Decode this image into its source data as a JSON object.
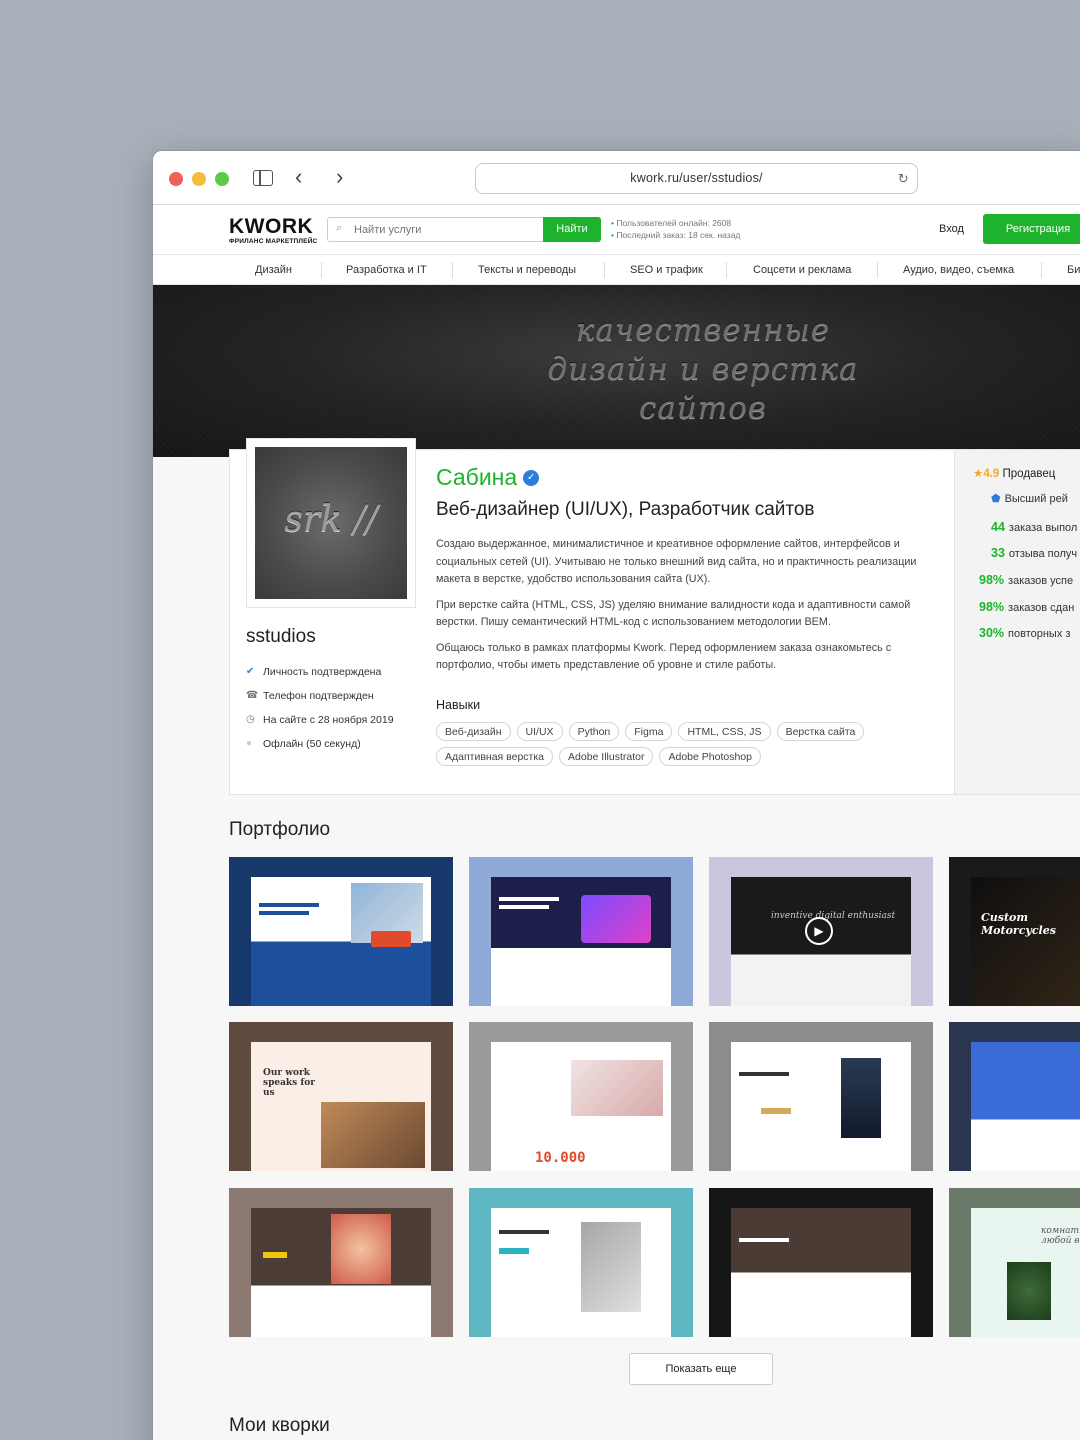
{
  "browser": {
    "url": "kwork.ru/user/sstudios/"
  },
  "header": {
    "logo": "KWORK",
    "logo_sub": "ФРИЛАНС МАРКЕТПЛЕЙС",
    "search_placeholder": "Найти услуги",
    "search_button": "Найти",
    "stats_online": "Пользователей онлайн: 2608",
    "stats_last_order": "Последний заказ: 18 сек. назад",
    "login": "Вход",
    "register": "Регистрация"
  },
  "categories": [
    "Дизайн",
    "Разработка и IT",
    "Тексты и переводы",
    "SEO и трафик",
    "Соцсети и реклама",
    "Аудио, видео, съемка",
    "Би"
  ],
  "banner": {
    "text": "качественные\nдизайн и верстка\nсайтов"
  },
  "profile": {
    "avatar_text": "srk //",
    "username": "sstudios",
    "facts": [
      {
        "icon": "verified-icon",
        "text": "Личность подтверждена"
      },
      {
        "icon": "phone-icon",
        "text": "Телефон подтвержден"
      },
      {
        "icon": "clock-icon",
        "text": "На сайте с 28 ноября 2019"
      },
      {
        "icon": "status-dot-icon",
        "text": "Офлайн (50 секунд)"
      }
    ],
    "name": "Сабина",
    "title": "Веб-дизайнер (UI/UX), Разработчик сайтов",
    "about": [
      "Создаю выдержанное, минималистичное и креативное оформление сайтов, интерфейсов и социальных сетей (UI). Учитываю не только внешний вид сайта, но и практичность реализации макета в верстке, удобство использования сайта (UX).",
      "При верстке сайта (HTML, CSS, JS) уделяю внимание валидности кода и адаптивности самой верстки. Пишу семантический HTML-код с использованием методологии BEM.",
      "Общаюсь только в рамках платформы Kwork. Перед оформлением заказа ознакомьтесь с портфолио, чтобы иметь представление об уровне и стиле работы."
    ],
    "skills_title": "Навыки",
    "skills": [
      "Веб-дизайн",
      "UI/UX",
      "Python",
      "Figma",
      "HTML, CSS, JS",
      "Верстка сайта",
      "Адаптивная верстка",
      "Adobe Illustrator",
      "Adobe Photoshop"
    ]
  },
  "seller": {
    "rating": "4.9",
    "rating_label": "Продавец",
    "rank": "Высший рей",
    "metrics": [
      {
        "value": "44",
        "label": "заказа выпол"
      },
      {
        "value": "33",
        "label": "отзыва получ"
      },
      {
        "value": "98%",
        "label": "заказов успе"
      },
      {
        "value": "98%",
        "label": "заказов сдан"
      },
      {
        "value": "30%",
        "label": "повторных з"
      }
    ]
  },
  "portfolio": {
    "title": "Портфолио",
    "labels": {
      "t3": "inventive digital enthusiast",
      "t4": "Custom Motorcycles",
      "t5": "Our work speaks for us",
      "t6": "10.000",
      "t12": "комнатные рас на любой вк"
    },
    "show_more": "Показать еще"
  },
  "kworks": {
    "title": "Мои кворки"
  },
  "colors": {
    "accent": "#1db32c",
    "verified": "#2c7fd8",
    "star": "#f5a623"
  }
}
